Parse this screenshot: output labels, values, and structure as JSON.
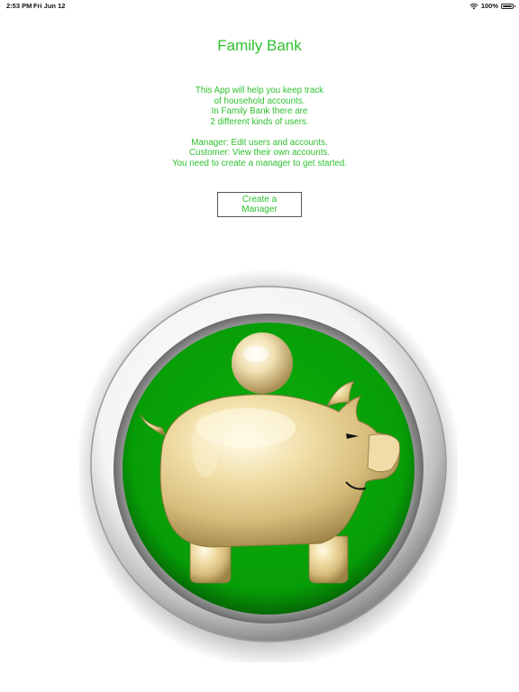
{
  "status_bar": {
    "time": "2:53 PM",
    "date": "Fri Jun 12",
    "battery": "100%",
    "icons": [
      "wifi-icon",
      "battery-icon"
    ]
  },
  "app": {
    "title": "Family Bank",
    "intro_lines": [
      "This App will help you keep track",
      "of household accounts.",
      "In Family Bank there are",
      "2 different kinds of users."
    ],
    "role_lines": [
      "Manager: Edit users and accounts.",
      "Customer: View their own accounts.",
      "You need to create a manager to get started."
    ],
    "create_button_label": "Create a Manager"
  },
  "colors": {
    "accent_text": "#2fc12f",
    "logo_green": "#0aa00a",
    "logo_silver": "#c8c8c8",
    "pig_gold": "#e8d49c"
  },
  "logo": {
    "name": "piggy-bank-coin-logo"
  }
}
